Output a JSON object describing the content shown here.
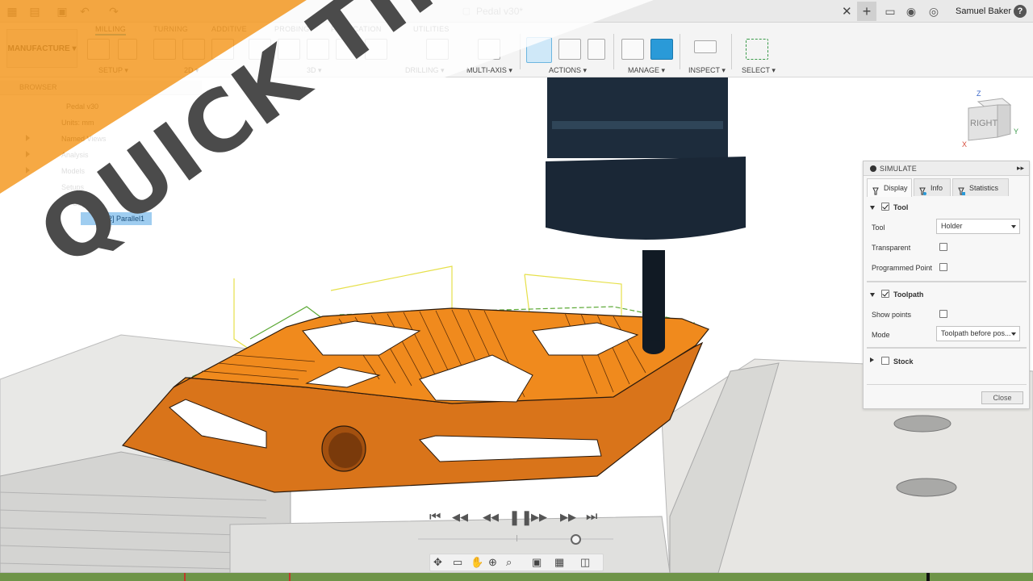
{
  "titlebar": {
    "doc_title": "Pedal v30*",
    "user_name": "Samuel Baker",
    "close_glyph": "✕",
    "plus_glyph": "+",
    "help_glyph": "?"
  },
  "toolbar": {
    "workspace": "MANUFACTURE ▾",
    "tabs": [
      "MILLING",
      "TURNING",
      "ADDITIVE",
      "PROBING",
      "FABRICATION",
      "UTILITIES"
    ],
    "groups": {
      "setup": "SETUP ▾",
      "two_d": "2D ▾",
      "three_d": "3D ▾",
      "drilling": "DRILLING ▾",
      "multi_axis": "MULTI-AXIS ▾",
      "actions": "ACTIONS ▾",
      "manage": "MANAGE ▾",
      "inspect": "INSPECT ▾",
      "select": "SELECT ▾"
    }
  },
  "browser": {
    "title": "BROWSER",
    "items": [
      {
        "label": "Pedal v30"
      },
      {
        "label": "Units: mm"
      },
      {
        "label": "Named Views"
      },
      {
        "label": "Analysis"
      },
      {
        "label": "Models"
      },
      {
        "label": "Setups"
      },
      {
        "label": "Setup1"
      },
      {
        "label": "[T2] Parallel1"
      }
    ]
  },
  "viewcube": {
    "face": "RIGHT",
    "z": "Z",
    "y": "Y",
    "x": "X"
  },
  "simulate": {
    "title": "SIMULATE",
    "tabs": [
      "Display",
      "Info",
      "Statistics"
    ],
    "tool_section": "Tool",
    "tool_label": "Tool",
    "tool_value": "Holder",
    "transparent_label": "Transparent",
    "programmed_point_label": "Programmed Point",
    "toolpath_section": "Toolpath",
    "show_points_label": "Show points",
    "mode_label": "Mode",
    "mode_value": "Toolpath before pos...",
    "stock_section": "Stock",
    "close_label": "Close",
    "tool_checked": true,
    "toolpath_checked": true,
    "stock_checked": false,
    "transparent_checked": false,
    "programmed_point_checked": false,
    "show_points_checked": false
  },
  "overlay": {
    "text": "QUICK TIP"
  },
  "colors": {
    "accent_orange": "#f59a23",
    "part_orange": "#f08a1d",
    "tool_blue": "#1d2c3c",
    "selection_blue": "#2a9ad8",
    "toolpath_green": "#5aa833",
    "toolpath_yellow": "#e6e04a",
    "timeline_green": "#6e9448"
  },
  "playback": {
    "first": "⏮",
    "prev_op": "◀◀",
    "rewind": "◀◀",
    "pause": "❚❚",
    "forward": "▶▶",
    "next_op": "▶▶",
    "last": "⏭",
    "progress": 0.81
  }
}
